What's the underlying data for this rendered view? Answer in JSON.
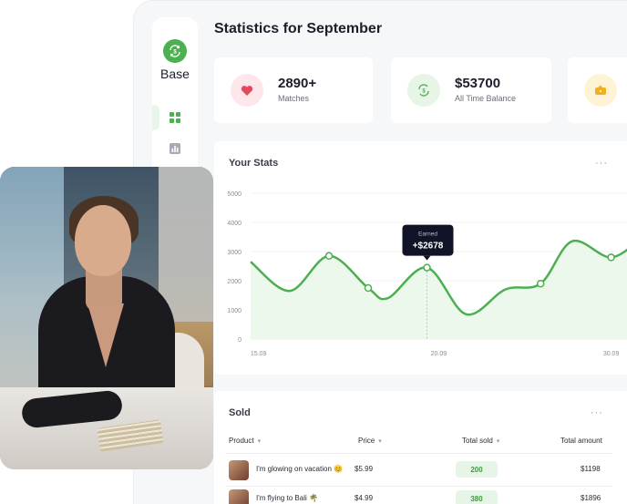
{
  "sidebar": {
    "brand": "Base",
    "logo_icon": "dollar-cycle-icon",
    "nav": [
      {
        "name": "dashboard",
        "icon": "grid-icon",
        "active": true
      },
      {
        "name": "analytics",
        "icon": "bar-chart-icon",
        "active": false
      }
    ]
  },
  "header": {
    "title": "Statistics for September"
  },
  "kpis": [
    {
      "value": "2890+",
      "label": "Matches",
      "icon": "heart-icon",
      "icon_bg": "#fde7ea",
      "icon_color": "#e34a5e"
    },
    {
      "value": "$53700",
      "label": "All Time Balance",
      "icon": "dollar-cycle-icon",
      "icon_bg": "#e6f5e6",
      "icon_color": "#4caf50"
    },
    {
      "value": "",
      "label": "",
      "icon": "wallet-icon",
      "icon_bg": "#fff3d6",
      "icon_color": "#f2b01e"
    }
  ],
  "stats": {
    "title": "Your Stats",
    "more_label": "···",
    "tooltip": {
      "title": "Earned",
      "value": "+$2678"
    },
    "chart_data": {
      "type": "area",
      "title": "Your Stats",
      "xlabel": "",
      "ylabel": "",
      "ylim": [
        0,
        5000
      ],
      "yticks": [
        "5000",
        "4000",
        "3000",
        "2000",
        "1000",
        "0"
      ],
      "xticks": [
        "15.09",
        "20.09",
        "30.09"
      ],
      "series": [
        {
          "x": [
            0,
            0.1,
            0.2,
            0.3,
            0.35,
            0.45,
            0.55,
            0.65,
            0.74,
            0.82,
            0.92,
            1.0
          ],
          "values": [
            2650,
            1650,
            2850,
            1750,
            1400,
            2450,
            850,
            1700,
            1900,
            3350,
            2800,
            3500
          ],
          "markers": [
            2,
            3,
            5,
            8,
            10
          ]
        }
      ],
      "colors": {
        "line": "#4caf50",
        "fill": "#e8f6e9"
      },
      "grid": true
    }
  },
  "sold": {
    "title": "Sold",
    "more_label": "···",
    "columns": [
      {
        "label": "Product",
        "sort": "▾"
      },
      {
        "label": "Price",
        "sort": "▾"
      },
      {
        "label": "Total sold",
        "sort": "▾"
      },
      {
        "label": "Total amount",
        "sort": ""
      }
    ],
    "rows": [
      {
        "product": "I'm glowing on vacation 😊",
        "price": "$5.99",
        "total_sold": "200",
        "total_amount": "$1198"
      },
      {
        "product": "I'm flying to Bali 🌴",
        "price": "$4.99",
        "total_sold": "380",
        "total_amount": "$1896"
      }
    ]
  }
}
